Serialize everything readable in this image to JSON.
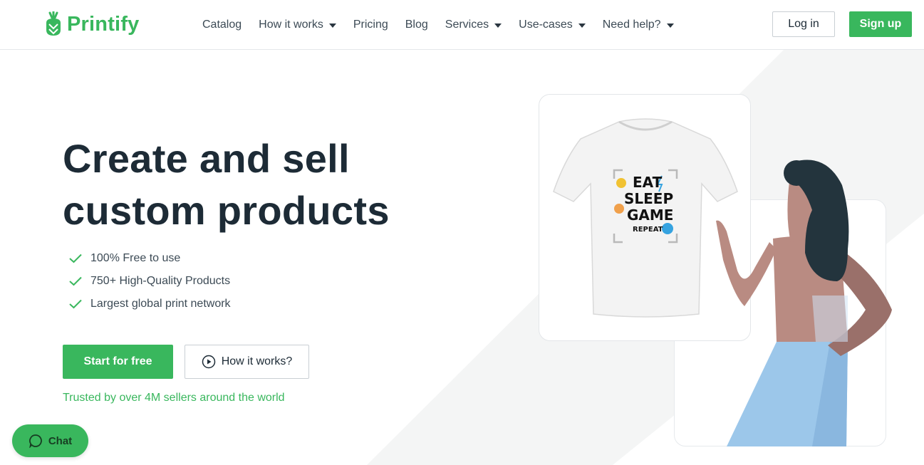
{
  "brand": {
    "name": "Printify",
    "color": "#39b75d"
  },
  "nav": {
    "items": [
      {
        "label": "Catalog",
        "dropdown": false
      },
      {
        "label": "How it works",
        "dropdown": true
      },
      {
        "label": "Pricing",
        "dropdown": false
      },
      {
        "label": "Blog",
        "dropdown": false
      },
      {
        "label": "Services",
        "dropdown": true
      },
      {
        "label": "Use-cases",
        "dropdown": true
      },
      {
        "label": "Need help?",
        "dropdown": true
      }
    ],
    "login_label": "Log in",
    "signup_label": "Sign up"
  },
  "hero": {
    "headline_line1": "Create and sell",
    "headline_line2": "custom products",
    "features": [
      "100% Free to use",
      "750+ High-Quality Products",
      "Largest global print network"
    ],
    "primary_cta": "Start for free",
    "secondary_cta": "How it works?",
    "trusted_text": "Trusted by over 4M sellers around the world"
  },
  "illustration": {
    "tshirt_print_lines": [
      "EAT",
      "SLEEP",
      "GAME",
      "REPEAT"
    ]
  },
  "chat": {
    "label": "Chat"
  },
  "colors": {
    "accent": "#39b75d",
    "text": "#1d2b36",
    "skin": "#b98b82",
    "hair": "#23343d",
    "skirt": "#9cc7ea"
  }
}
